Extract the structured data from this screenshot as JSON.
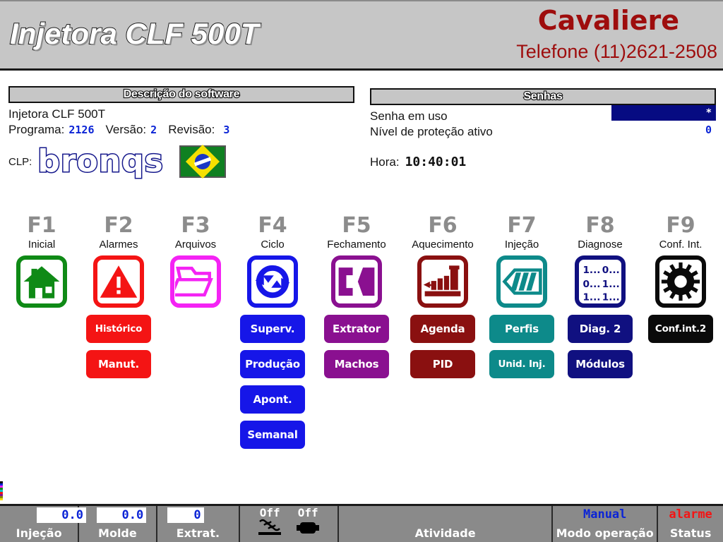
{
  "header": {
    "machine_title": "Injetora CLF 500T",
    "company": "Cavaliere",
    "phone": "Telefone (11)2621-2508"
  },
  "software_panel": {
    "title": "Descrição do software",
    "machine": "Injetora CLF 500T",
    "program_label": "Programa:",
    "program_value": "2126",
    "version_label": "Versão:",
    "version_value": "2",
    "revision_label": "Revisão:",
    "revision_value": "3",
    "plc_label": "CLP:",
    "plc_brand": "bronqs",
    "flag": "brazil-flag"
  },
  "passwords_panel": {
    "title": "Senhas",
    "password_in_use_label": "Senha em uso",
    "password_in_use_value": "*",
    "protection_level_label": "Nível de proteção ativo",
    "protection_level_value": "0",
    "time_label": "Hora:",
    "time_value": "10:40:01"
  },
  "function_keys": [
    {
      "key": "F1",
      "label": "Inicial",
      "icon": "home-icon",
      "color": "#0f8a16",
      "subbuttons": []
    },
    {
      "key": "F2",
      "label": "Alarmes",
      "icon": "warning-triangle-icon",
      "color": "#f41414",
      "subbuttons": [
        {
          "label": "Histórico",
          "color": "#f41414"
        },
        {
          "label": "Manut.",
          "color": "#f41414"
        }
      ]
    },
    {
      "key": "F3",
      "label": "Arquivos",
      "icon": "open-folder-icon",
      "color": "#f423f4",
      "subbuttons": []
    },
    {
      "key": "F4",
      "label": "Ciclo",
      "icon": "cycle-arrows-icon",
      "color": "#1616e8",
      "subbuttons": [
        {
          "label": "Superv.",
          "color": "#1616e8"
        },
        {
          "label": "Produção",
          "color": "#1616e8"
        },
        {
          "label": "Apont.",
          "color": "#1616e8"
        },
        {
          "label": "Semanal",
          "color": "#1616e8"
        }
      ]
    },
    {
      "key": "F5",
      "label": "Fechamento",
      "icon": "mold-clamp-icon",
      "color": "#8a1090",
      "subbuttons": [
        {
          "label": "Extrator",
          "color": "#8a1090"
        },
        {
          "label": "Machos",
          "color": "#8a1090"
        }
      ]
    },
    {
      "key": "F6",
      "label": "Aquecimento",
      "icon": "heater-barrel-icon",
      "color": "#8a1010",
      "subbuttons": [
        {
          "label": "Agenda",
          "color": "#8a1010"
        },
        {
          "label": "PID",
          "color": "#8a1010"
        }
      ]
    },
    {
      "key": "F7",
      "label": "Injeção",
      "icon": "screw-auger-icon",
      "color": "#0d8a8a",
      "subbuttons": [
        {
          "label": "Perfis",
          "color": "#0d8a8a"
        },
        {
          "label": "Unid. Inj.",
          "color": "#0d8a8a"
        }
      ]
    },
    {
      "key": "F8",
      "label": "Diagnose",
      "icon": "bit-table-icon",
      "color": "#101080",
      "subbuttons": [
        {
          "label": "Diag. 2",
          "color": "#101080"
        },
        {
          "label": "Módulos",
          "color": "#101080"
        }
      ]
    },
    {
      "key": "F9",
      "label": "Conf. Int.",
      "icon": "gear-icon",
      "color": "#0a0a0a",
      "subbuttons": [
        {
          "label": "Conf.int.2",
          "color": "#0a0a0a"
        }
      ]
    }
  ],
  "diagnose_icon_text": {
    "r1c1": "1...",
    "r1c2": "0...",
    "r2c1": "0...",
    "r2c2": "1...",
    "r3c1": "1...",
    "r3c2": "1..."
  },
  "status_bar": {
    "injection": {
      "value": "0.0",
      "caption": "Injeção"
    },
    "mold": {
      "value": "0.0",
      "caption": "Molde"
    },
    "extractor": {
      "value": "0",
      "caption": "Extrat."
    },
    "heater": {
      "state": "Off",
      "icon": "heater-icon"
    },
    "motor": {
      "state": "Off",
      "icon": "motor-icon"
    },
    "activity": {
      "value": "",
      "caption": "Atividade"
    },
    "operation_mode": {
      "value": "Manual",
      "caption": "Modo operação"
    },
    "status": {
      "value": "alarme",
      "caption": "Status"
    }
  },
  "colors": {
    "header_bg": "#c6c6c6",
    "brand_red": "#9e0d0d",
    "value_blue": "#0b24d6",
    "status_bg": "#8a8a8a",
    "alarm_red": "#f41414"
  }
}
